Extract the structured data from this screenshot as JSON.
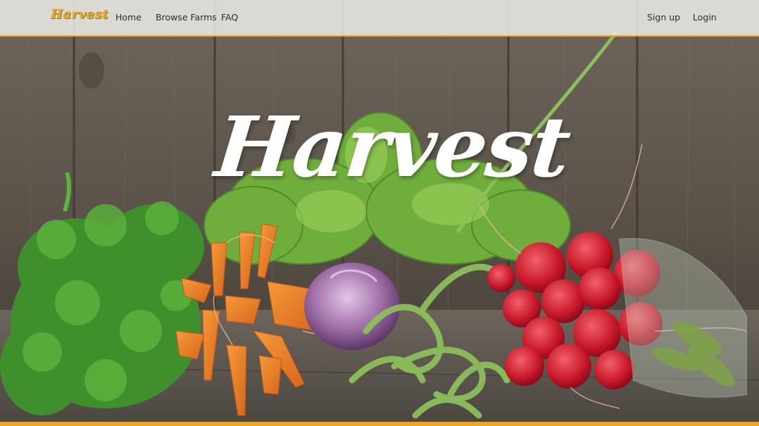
{
  "navbar": {
    "brand": "Harvest",
    "links": [
      "Home",
      "Browse Farms",
      "FAQ"
    ],
    "auth": {
      "signup": "Sign up",
      "login": "Login"
    }
  },
  "hero": {
    "title": "Harvest",
    "image_subject": "fresh-vegetables-photo"
  },
  "colors": {
    "accent": "#f0a71c",
    "nav_background": "#eeece8",
    "title": "#ffffff"
  }
}
